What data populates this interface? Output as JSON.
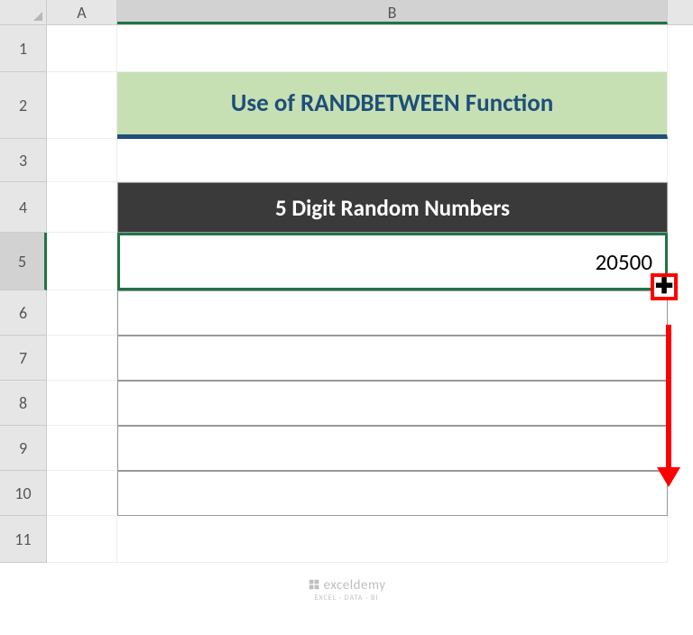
{
  "columns": {
    "A": "A",
    "B": "B"
  },
  "rows": {
    "r1": "1",
    "r2": "2",
    "r3": "3",
    "r4": "4",
    "r5": "5",
    "r6": "6",
    "r7": "7",
    "r8": "8",
    "r9": "9",
    "r10": "10",
    "r11": "11"
  },
  "title": "Use of RANDBETWEEN Function",
  "table_header": "5 Digit Random Numbers",
  "active_value": "20500",
  "watermark": {
    "brand": "exceldemy",
    "tagline": "EXCEL · DATA · BI"
  },
  "fill_handle_glyph": "✚"
}
